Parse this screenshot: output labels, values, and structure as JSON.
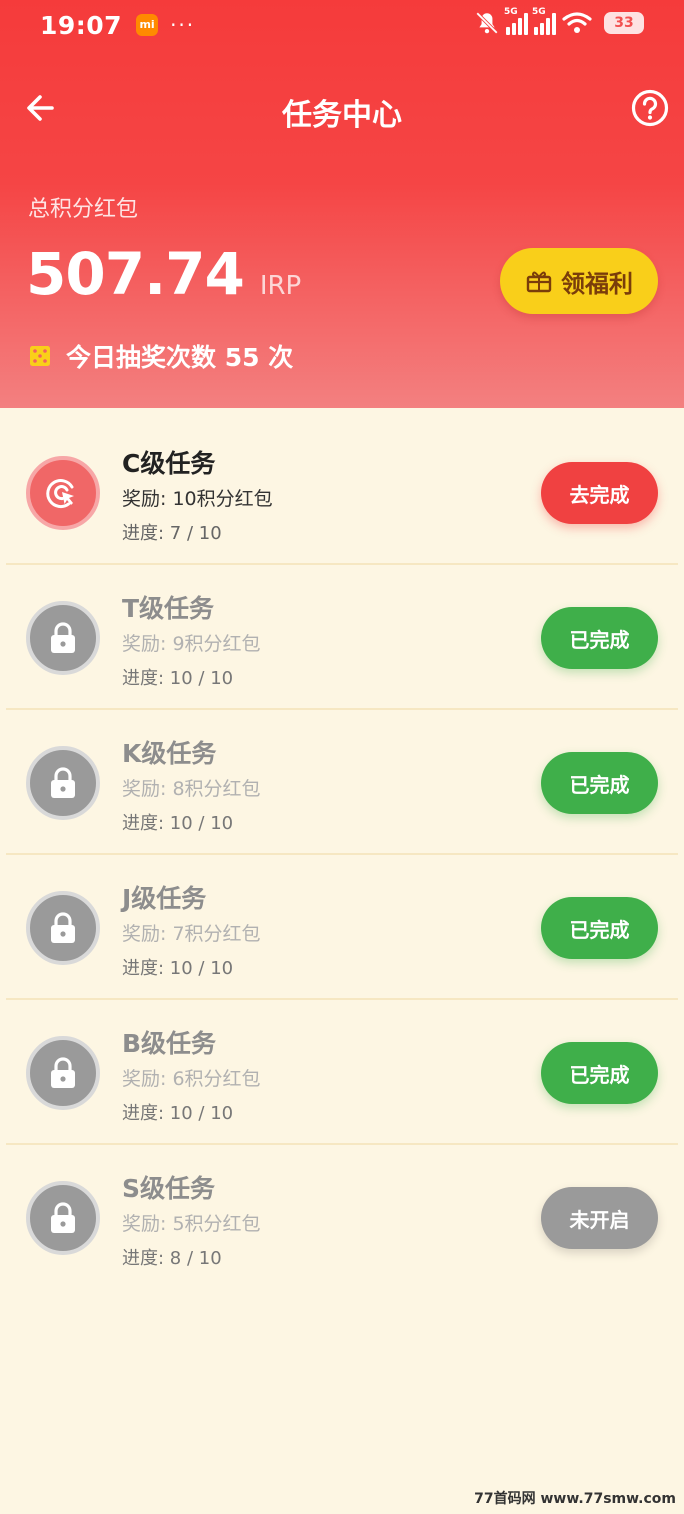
{
  "status_bar": {
    "time": "19:07",
    "mi_badge": "mi",
    "dots": "···",
    "network_labels": [
      "5G",
      "5G"
    ],
    "battery": "33"
  },
  "nav": {
    "title": "任务中心",
    "back_icon": "arrow-left-icon",
    "help_icon": "question-circle-icon"
  },
  "summary": {
    "label": "总积分红包",
    "amount": "507.74",
    "unit": "IRP",
    "welfare_button": "领福利",
    "lottery_text": "今日抽奖次数 55 次"
  },
  "tasks": [
    {
      "title": "C级任务",
      "reward": "奖励: 10积分红包",
      "progress": "进度: 7 / 10",
      "button": "去完成",
      "state": "active"
    },
    {
      "title": "T级任务",
      "reward": "奖励: 9积分红包",
      "progress": "进度: 10 / 10",
      "button": "已完成",
      "state": "done"
    },
    {
      "title": "K级任务",
      "reward": "奖励: 8积分红包",
      "progress": "进度: 10 / 10",
      "button": "已完成",
      "state": "done"
    },
    {
      "title": "J级任务",
      "reward": "奖励: 7积分红包",
      "progress": "进度: 10 / 10",
      "button": "已完成",
      "state": "done"
    },
    {
      "title": "B级任务",
      "reward": "奖励: 6积分红包",
      "progress": "进度: 10 / 10",
      "button": "已完成",
      "state": "done"
    },
    {
      "title": "S级任务",
      "reward": "奖励: 5积分红包",
      "progress": "进度: 8 / 10",
      "button": "未开启",
      "state": "closed"
    }
  ],
  "watermark": "77首码网 www.77smw.com",
  "colors": {
    "header_red": "#f53b3b",
    "welfare_yellow": "#f9cf1a",
    "go_red": "#f04141",
    "done_green": "#3faf4a",
    "closed_gray": "#9a9a9a",
    "page_bg": "#fdf6e3"
  }
}
